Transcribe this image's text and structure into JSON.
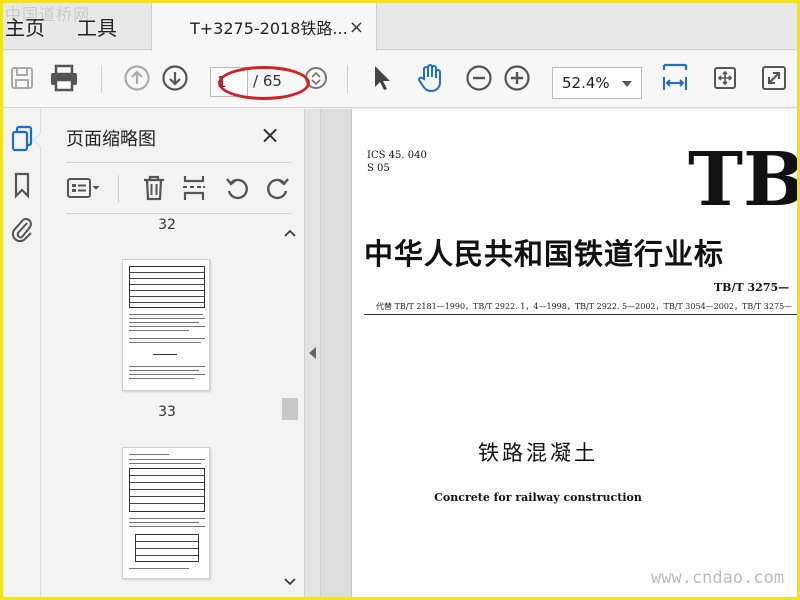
{
  "tabs": {
    "home": "主页",
    "tools": "工具",
    "document": "T+3275-2018铁路...",
    "close": "×"
  },
  "watermarks": {
    "top": "中国道桥网",
    "bottom": "www.cndao.com"
  },
  "toolbar": {
    "current_page": "1",
    "page_total": "/ 65",
    "zoom": "52.4%"
  },
  "thumbnail_panel": {
    "title": "页面缩略图",
    "close": "×",
    "pages": [
      {
        "number": "32"
      },
      {
        "number": "33"
      }
    ]
  },
  "document": {
    "ics": "ICS 45. 040",
    "category": "S 05",
    "logo": "TB",
    "title": "中华人民共和国铁道行业标",
    "number": "TB/T 3275—",
    "replaces": "代替 TB/T 2181—1990，TB/T 2922. 1，4—1998，TB/T 2922. 5—2002，TB/T 3054—2002，TB/T 3275—",
    "cn_title": "铁路混凝土",
    "en_title": "Concrete for railway construction"
  },
  "colors": {
    "frame": "#f5e31a",
    "accent_blue": "#1b6fd1",
    "annotation_red": "#d61f1f"
  }
}
